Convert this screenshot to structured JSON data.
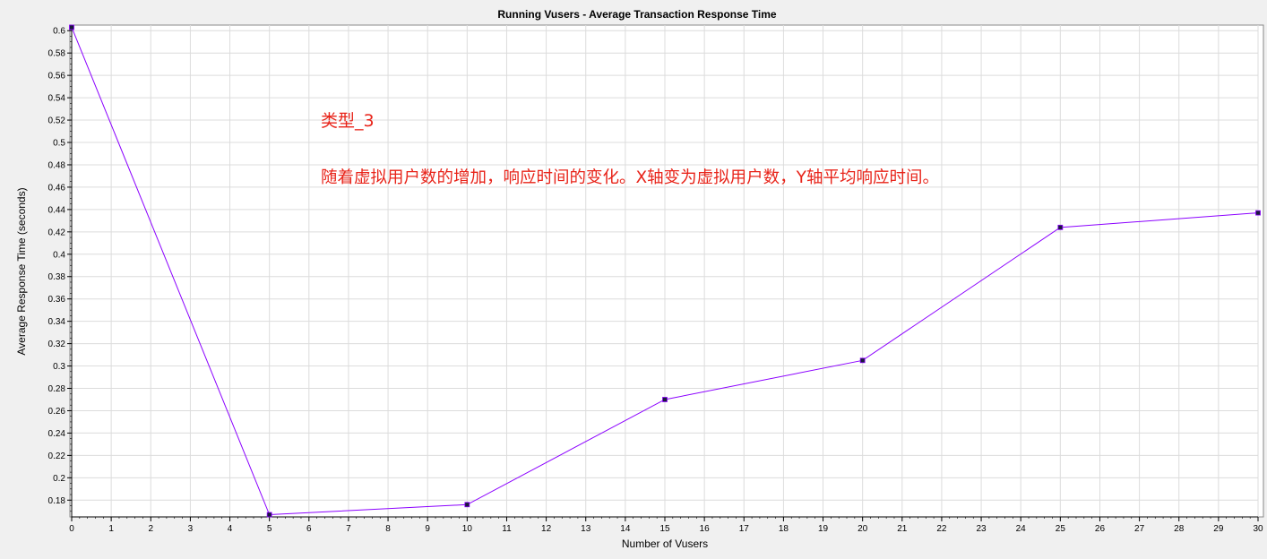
{
  "chart_data": {
    "type": "line",
    "title": "Running Vusers - Average Transaction Response Time",
    "xlabel": "Number of Vusers",
    "ylabel": "Average Response Time (seconds)",
    "xlim": [
      0,
      30
    ],
    "ylim": [
      0.165,
      0.605
    ],
    "x_ticks": [
      0,
      1,
      2,
      3,
      4,
      5,
      6,
      7,
      8,
      9,
      10,
      11,
      12,
      13,
      14,
      15,
      16,
      17,
      18,
      19,
      20,
      21,
      22,
      23,
      24,
      25,
      26,
      27,
      28,
      29,
      30
    ],
    "y_ticks": [
      "0.18",
      "0.2",
      "0.22",
      "0.24",
      "0.26",
      "0.28",
      "0.3",
      "0.32",
      "0.34",
      "0.36",
      "0.38",
      "0.4",
      "0.42",
      "0.44",
      "0.46",
      "0.48",
      "0.5",
      "0.52",
      "0.54",
      "0.56",
      "0.58",
      "0.6"
    ],
    "grid": true,
    "series": [
      {
        "color": "#8b00ff",
        "points": [
          {
            "x": 0,
            "y": 0.603
          },
          {
            "x": 5,
            "y": 0.167
          },
          {
            "x": 10,
            "y": 0.176
          },
          {
            "x": 15,
            "y": 0.27
          },
          {
            "x": 20,
            "y": 0.305
          },
          {
            "x": 25,
            "y": 0.424
          },
          {
            "x": 30,
            "y": 0.437
          }
        ]
      }
    ],
    "annotations": {
      "label": "类型_3",
      "description": "随着虚拟用户数的增加，响应时间的变化。X轴变为虚拟用户数，Y轴平均响应时间。",
      "color": "#e8241a"
    }
  }
}
